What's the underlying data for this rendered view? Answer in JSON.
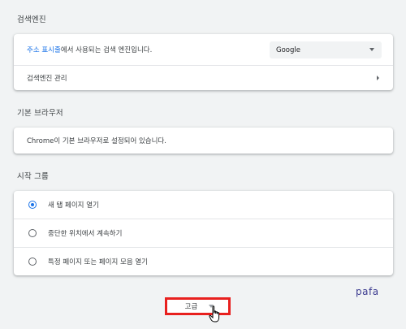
{
  "search_engine": {
    "section_title": "검색엔진",
    "address_bar_row": {
      "link_text": "주소 표시줄",
      "text": "에서 사용되는 검색 엔진입니다."
    },
    "engine_select": {
      "selected": "Google"
    },
    "manage_row": {
      "label": "검색엔진 관리"
    }
  },
  "default_browser": {
    "section_title": "기본 브라우저",
    "status": "Chrome이 기본 브라우저로 설정되어 있습니다."
  },
  "startup": {
    "section_title": "시작 그룹",
    "options": [
      {
        "label": "새 탭 페이지 열기",
        "checked": true
      },
      {
        "label": "중단한 위치에서 계속하기",
        "checked": false
      },
      {
        "label": "특정 페이지 또는 페이지 모음 열기",
        "checked": false
      }
    ]
  },
  "advanced_button": {
    "label": "고급"
  },
  "watermark": "pafa",
  "colors": {
    "accent": "#1a73e8",
    "highlight_border": "#e8201e"
  }
}
